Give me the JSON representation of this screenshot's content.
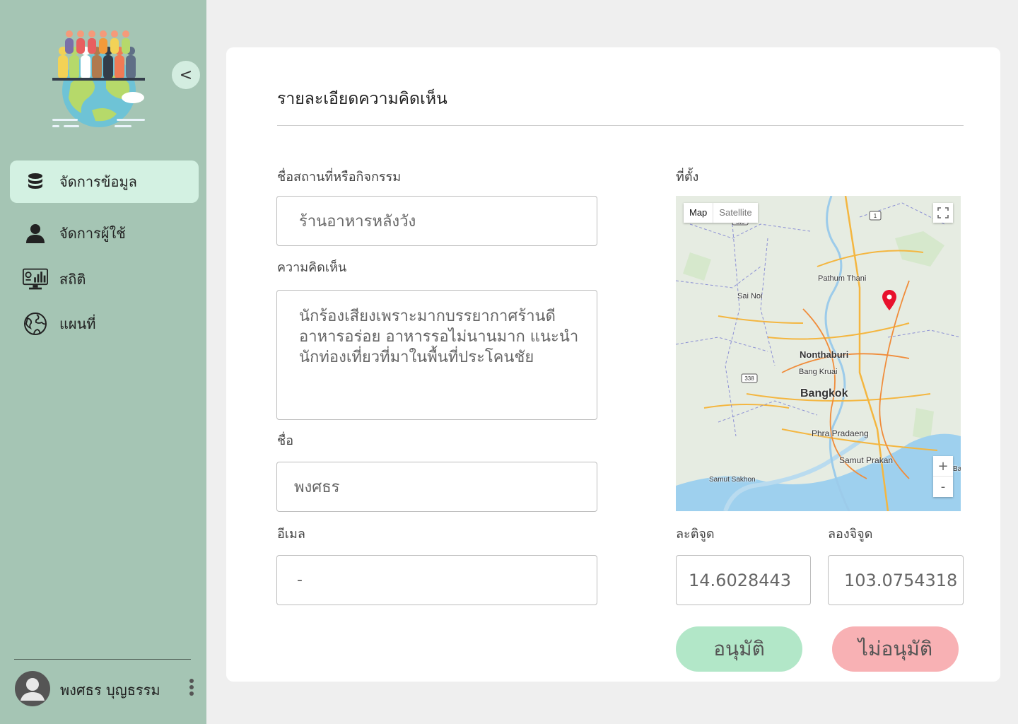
{
  "sidebar": {
    "collapse_label": "<",
    "items": [
      {
        "label": "จัดการข้อมูล",
        "icon": "database-icon",
        "active": true
      },
      {
        "label": "จัดการผู้ใช้",
        "icon": "user-icon",
        "active": false
      },
      {
        "label": "สถิติ",
        "icon": "statistics-monitor-icon",
        "active": false
      },
      {
        "label": "แผนที่",
        "icon": "globe-icon",
        "active": false
      }
    ],
    "user": {
      "name": "พงศธร บุญธรรม"
    }
  },
  "detail": {
    "title": "รายละเอียดความคิดเห็น",
    "place_label": "ชื่อสถานที่หรือกิจกรรม",
    "place_value": "ร้านอาหารหลังวัง",
    "comment_label": "ความคิดเห็น",
    "comment_value": "นักร้องเสียงเพราะมากบรรยากาศร้านดี\nอาหารอร่อย อาหารรอไม่นานมาก แนะนำ\nนักท่องเที่ยวที่มาในพื้นที่ประโคนชัย",
    "name_label": "ชื่อ",
    "name_value": "พงศธร",
    "email_label": "อีเมล",
    "email_value": "-",
    "location_label": "ที่ตั้ง",
    "lat_label": "ละติจูด",
    "lat_value": "14.6028443",
    "lng_label": "ลองจิจูด",
    "lng_value": "103.0754318",
    "approve_label": "อนุมัติ",
    "reject_label": "ไม่อนุมัติ"
  },
  "map": {
    "type_map": "Map",
    "type_satellite": "Satellite",
    "zoom_in": "+",
    "zoom_out": "-",
    "places": [
      "Pathum Thani",
      "Sai Noi",
      "Nonthaburi",
      "Bang Kruai",
      "Bangkok",
      "Phra Pradaeng",
      "Samut Prakan",
      "Samut Sakhon",
      "Ba"
    ],
    "road_shields": [
      "1",
      "338",
      "346"
    ]
  },
  "colors": {
    "sidebar_bg": "#a5c5b4",
    "active_item_bg": "#d3f1e2",
    "approve_bg": "#b2e7c8",
    "reject_bg": "#f8b1b4",
    "pin": "#e8112d"
  }
}
